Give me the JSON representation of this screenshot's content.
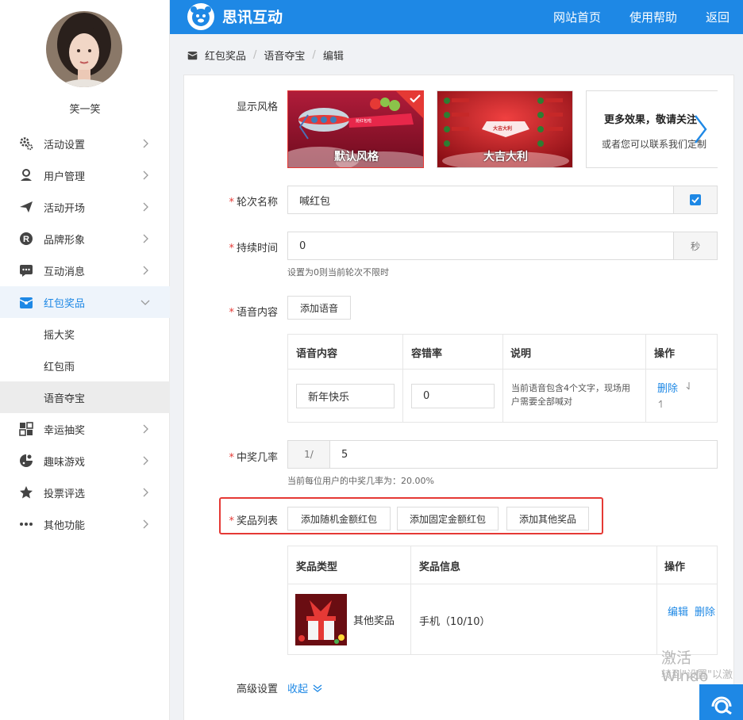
{
  "app": {
    "brand": "思讯互动"
  },
  "topnav": {
    "home": "网站首页",
    "help": "使用帮助",
    "back": "返回"
  },
  "user": {
    "name": "笑一笑"
  },
  "sidebar": {
    "items": [
      {
        "label": "活动设置",
        "icon": "gear-icon"
      },
      {
        "label": "用户管理",
        "icon": "user-icon"
      },
      {
        "label": "活动开场",
        "icon": "paper-plane-icon"
      },
      {
        "label": "品牌形象",
        "icon": "registered-icon"
      },
      {
        "label": "互动消息",
        "icon": "chat-bubble-icon"
      },
      {
        "label": "红包奖品",
        "icon": "red-packet-icon"
      },
      {
        "label": "幸运抽奖",
        "icon": "lottery-icon"
      },
      {
        "label": "趣味游戏",
        "icon": "gamepad-icon"
      },
      {
        "label": "投票评选",
        "icon": "star-icon"
      },
      {
        "label": "其他功能",
        "icon": "more-dots-icon"
      }
    ],
    "subitems": [
      "摇大奖",
      "红包雨",
      "语音夺宝"
    ],
    "active": "红包奖品",
    "selected_sub": "语音夺宝"
  },
  "breadcrumb": [
    "红包奖品",
    "语音夺宝",
    "编辑"
  ],
  "form": {
    "style": {
      "label": "显示风格",
      "options": [
        "默认风格",
        "大吉大利"
      ],
      "card_banner": "抢红包啦",
      "card2_title": "大吉大利",
      "more_title": "更多效果，敬请关注",
      "more_sub": "或者您可以联系我们定制",
      "selected": "默认风格"
    },
    "round_name": {
      "label": "轮次名称",
      "value": "喊红包"
    },
    "duration": {
      "label": "持续时间",
      "value": "0",
      "unit": "秒",
      "hint": "设置为0则当前轮次不限时"
    },
    "voice": {
      "label": "语音内容",
      "add_button": "添加语音",
      "columns": [
        "语音内容",
        "容错率",
        "说明",
        "操作"
      ],
      "rows": [
        {
          "content": "新年快乐",
          "tolerance": "0",
          "note": "当前语音包含4个文字，现场用户需要全部喊对",
          "action": "删除"
        }
      ]
    },
    "win_rate": {
      "label": "中奖几率",
      "prefix": "1/",
      "value": "5",
      "hint": "当前每位用户的中奖几率为：20.00%"
    },
    "prizes": {
      "label": "奖品列表",
      "buttons": [
        "添加随机金额红包",
        "添加固定金额红包",
        "添加其他奖品"
      ],
      "columns": [
        "奖品类型",
        "奖品信息",
        "操作"
      ],
      "rows": [
        {
          "type": "其他奖品",
          "info": "手机（10/10）",
          "edit": "编辑",
          "delete": "删除"
        }
      ]
    },
    "advanced": {
      "label": "高级设置",
      "toggle": "收起"
    }
  },
  "watermark": {
    "line1": "激活 Windo",
    "line2": "转到\"设置\"以激"
  },
  "colors": {
    "primary": "#1e88e5",
    "required": "#e53935",
    "highlight_box": "#e53935"
  }
}
